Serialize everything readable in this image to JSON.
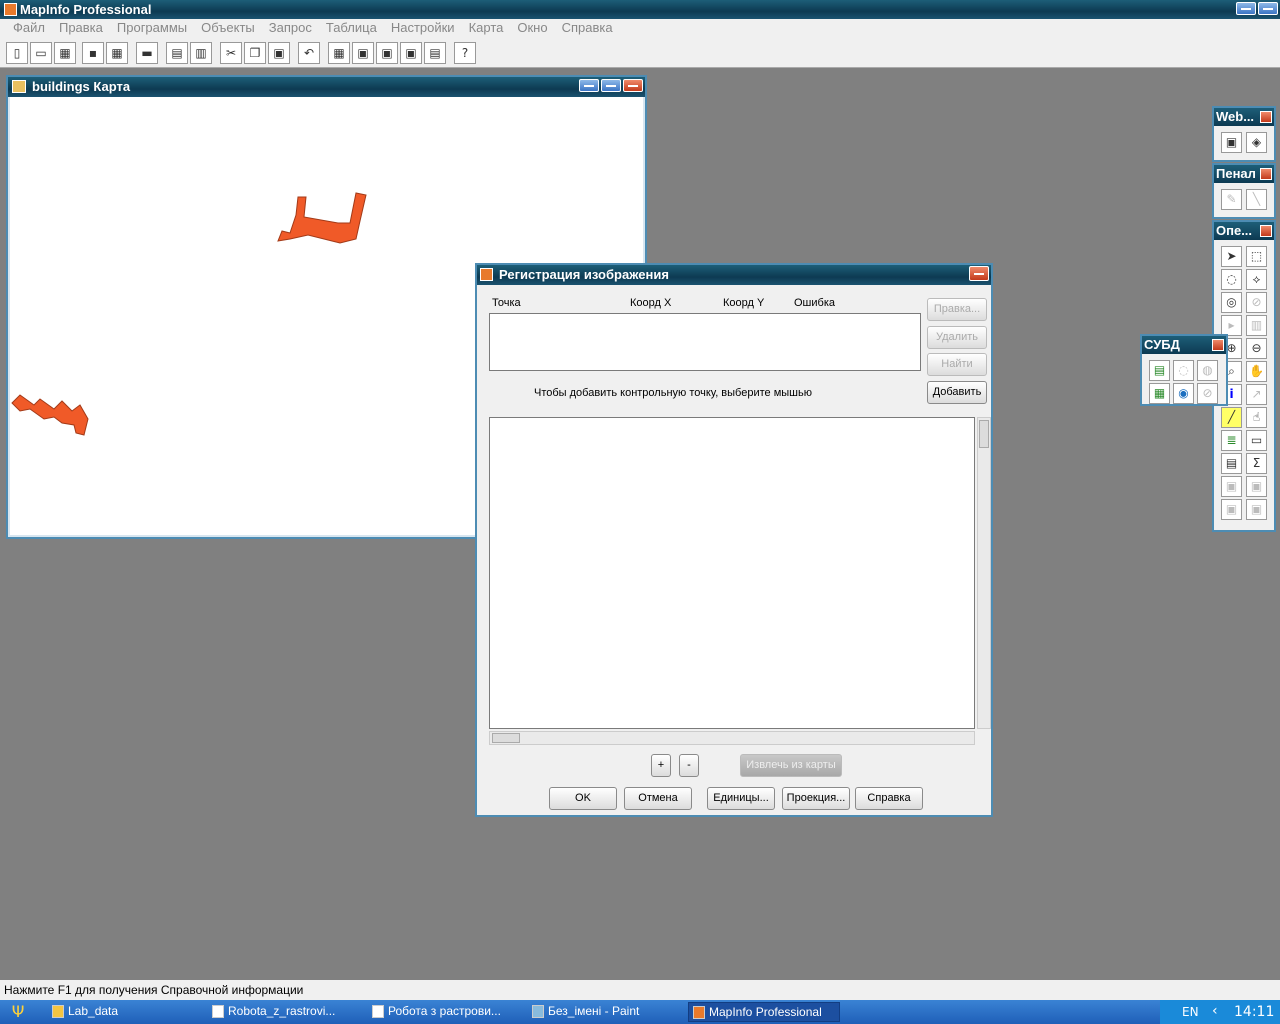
{
  "app": {
    "title": "MapInfo Professional"
  },
  "menu": [
    "Файл",
    "Правка",
    "Программы",
    "Объекты",
    "Запрос",
    "Таблица",
    "Настройки",
    "Карта",
    "Окно",
    "Справка"
  ],
  "map_window": {
    "title": "buildings Карта"
  },
  "dialog": {
    "title": "Регистрация изображения",
    "columns": [
      "Точка",
      "Коорд X",
      "Коорд Y",
      "Ошибка"
    ],
    "hint": "Чтобы добавить контрольную точку, выберите мышью",
    "side_buttons": [
      "Правка...",
      "Удалить",
      "Найти",
      "Добавить"
    ],
    "plus": "+",
    "minus": "-",
    "extract_button": "Извлечь из карты",
    "bottom_buttons": [
      "OK",
      "Отмена",
      "Единицы...",
      "Проекция...",
      "Справка"
    ]
  },
  "palettes": {
    "web": "Web...",
    "penal": "Пенал",
    "operations": "Опе...",
    "subd": "СУБД"
  },
  "status": "Нажмите F1 для получения Справочной информации",
  "taskbar": {
    "items": [
      "Lab_data",
      "Robota_z_rastrovi...",
      "Робота з растрови...",
      "Без_імені - Paint",
      "MapInfo Professional"
    ],
    "lang": "EN",
    "clock": "14:11"
  },
  "colors": {
    "shape_fill": "#f05a28",
    "titlebar": "#0d3a52",
    "desktop": "#808080"
  }
}
